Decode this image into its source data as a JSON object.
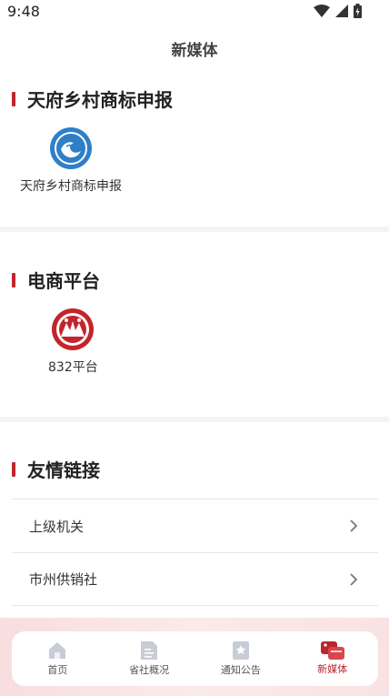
{
  "status_bar": {
    "time": "9:48",
    "icons": [
      "wifi-icon",
      "signal-icon",
      "battery-icon"
    ]
  },
  "header": {
    "title": "新媒体"
  },
  "sections": {
    "trademark": {
      "title": "天府乡村商标申报",
      "apps": [
        {
          "label": "天府乡村商标申报",
          "icon": "tianfu-logo-icon"
        }
      ]
    },
    "ecommerce": {
      "title": "电商平台",
      "apps": [
        {
          "label": "832平台",
          "icon": "platform-832-logo-icon"
        }
      ]
    },
    "links": {
      "title": "友情链接",
      "items": [
        {
          "label": "上级机关"
        },
        {
          "label": "市州供销社"
        }
      ]
    }
  },
  "tabbar": {
    "tabs": [
      {
        "label": "首页",
        "icon": "home-icon",
        "active": false
      },
      {
        "label": "省社概况",
        "icon": "document-icon",
        "active": false
      },
      {
        "label": "通知公告",
        "icon": "notice-icon",
        "active": false
      },
      {
        "label": "新媒体",
        "icon": "media-icon",
        "active": true
      }
    ]
  },
  "colors": {
    "accent": "#c0262d",
    "active_tab": "#b9262c"
  }
}
